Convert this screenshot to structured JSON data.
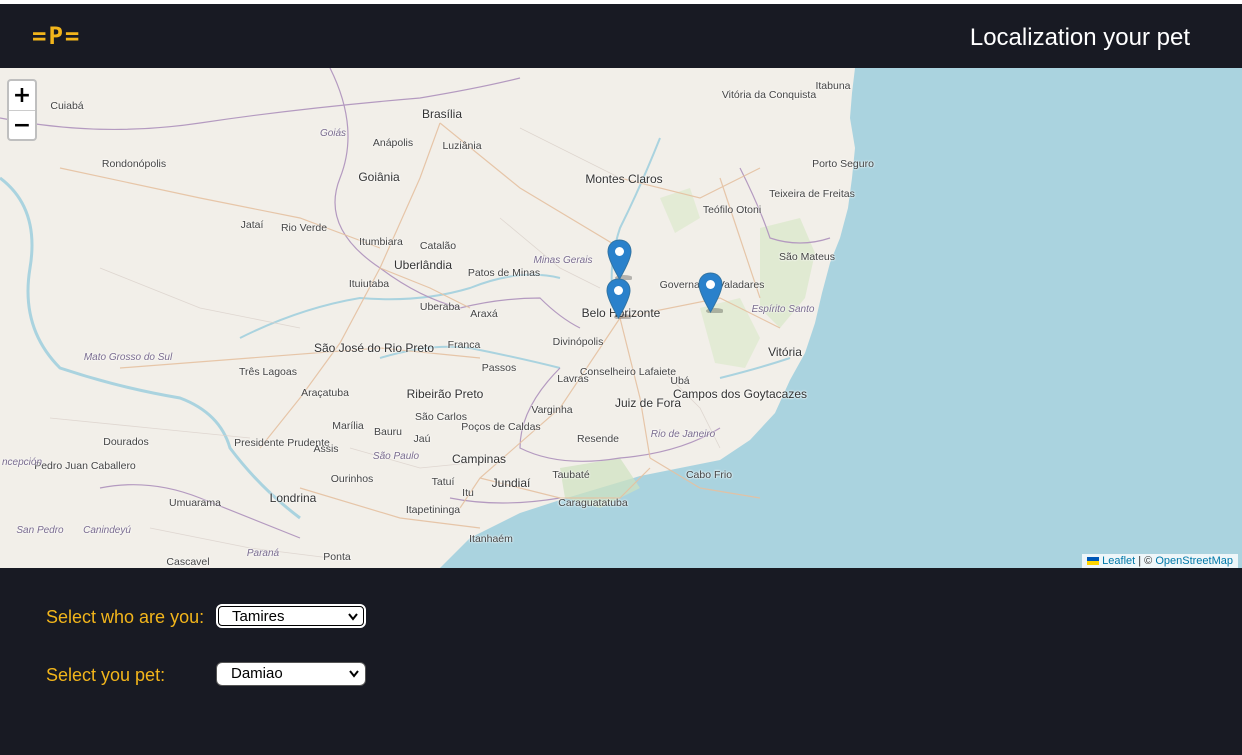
{
  "header": {
    "logo": "=P=",
    "title": "Localization your pet"
  },
  "map": {
    "zoom_in_label": "+",
    "zoom_out_label": "−",
    "attribution": {
      "leaflet": "Leaflet",
      "separator": "| ©",
      "osm": "OpenStreetMap"
    },
    "places": [
      {
        "name": "Cuiabá"
      },
      {
        "name": "Brasília"
      },
      {
        "name": "Goiás"
      },
      {
        "name": "Anápolis"
      },
      {
        "name": "Luziânia"
      },
      {
        "name": "Goiânia"
      },
      {
        "name": "Rondonópolis"
      },
      {
        "name": "Vitória da Conquista"
      },
      {
        "name": "Itabuna"
      },
      {
        "name": "Porto Seguro"
      },
      {
        "name": "Montes Claros"
      },
      {
        "name": "Teixeira de Freitas"
      },
      {
        "name": "Teófilo Otoni"
      },
      {
        "name": "Jataí"
      },
      {
        "name": "Rio Verde"
      },
      {
        "name": "Itumbiara"
      },
      {
        "name": "Catalão"
      },
      {
        "name": "Minas Gerais"
      },
      {
        "name": "São Mateus"
      },
      {
        "name": "Uberlândia"
      },
      {
        "name": "Patos de Minas"
      },
      {
        "name": "Governador Valadares"
      },
      {
        "name": "Ituiutaba"
      },
      {
        "name": "Espírito Santo"
      },
      {
        "name": "Uberaba"
      },
      {
        "name": "Araxá"
      },
      {
        "name": "Belo Horizonte"
      },
      {
        "name": "São José do Rio Preto"
      },
      {
        "name": "Divinópolis"
      },
      {
        "name": "Franca"
      },
      {
        "name": "Vitória"
      },
      {
        "name": "Mato Grosso do Sul"
      },
      {
        "name": "Três Lagoas"
      },
      {
        "name": "Passos"
      },
      {
        "name": "Conselheiro Lafaiete"
      },
      {
        "name": "Lavras"
      },
      {
        "name": "Ubá"
      },
      {
        "name": "Araçatuba"
      },
      {
        "name": "Ribeirão Preto"
      },
      {
        "name": "Campos dos Goytacazes"
      },
      {
        "name": "Juiz de Fora"
      },
      {
        "name": "Varginha"
      },
      {
        "name": "São Carlos"
      },
      {
        "name": "Poços de Caldas"
      },
      {
        "name": "Marília"
      },
      {
        "name": "Bauru"
      },
      {
        "name": "Jaú"
      },
      {
        "name": "Presidente Prudente"
      },
      {
        "name": "Dourados"
      },
      {
        "name": "Resende"
      },
      {
        "name": "Rio de Janeiro"
      },
      {
        "name": "Assis"
      },
      {
        "name": "São Paulo"
      },
      {
        "name": "Pedro Juan Caballero"
      },
      {
        "name": "ncepción"
      },
      {
        "name": "Campinas"
      },
      {
        "name": "Taubaté"
      },
      {
        "name": "Cabo Frio"
      },
      {
        "name": "Ourinhos"
      },
      {
        "name": "Tatuí"
      },
      {
        "name": "Jundiaí"
      },
      {
        "name": "Londrina"
      },
      {
        "name": "Itu"
      },
      {
        "name": "Umuarama"
      },
      {
        "name": "Itapetininga"
      },
      {
        "name": "Caraguatatuba"
      },
      {
        "name": "San Pedro"
      },
      {
        "name": "Canindeyú"
      },
      {
        "name": "Itanhaém"
      },
      {
        "name": "Paraná"
      },
      {
        "name": "Ponta"
      },
      {
        "name": "Cascavel"
      }
    ],
    "markers": [
      {
        "name": "pet-marker-1"
      },
      {
        "name": "pet-marker-2"
      },
      {
        "name": "pet-marker-3"
      }
    ]
  },
  "form": {
    "who_label": "Select who are you:",
    "who_value": "Tamires",
    "pet_label": "Select you pet:",
    "pet_value": "Damiao"
  },
  "colors": {
    "accent": "#f2b51b",
    "background": "#181a23",
    "water": "#aad3df",
    "land": "#f2efe9",
    "marker": "#2a81cb"
  }
}
